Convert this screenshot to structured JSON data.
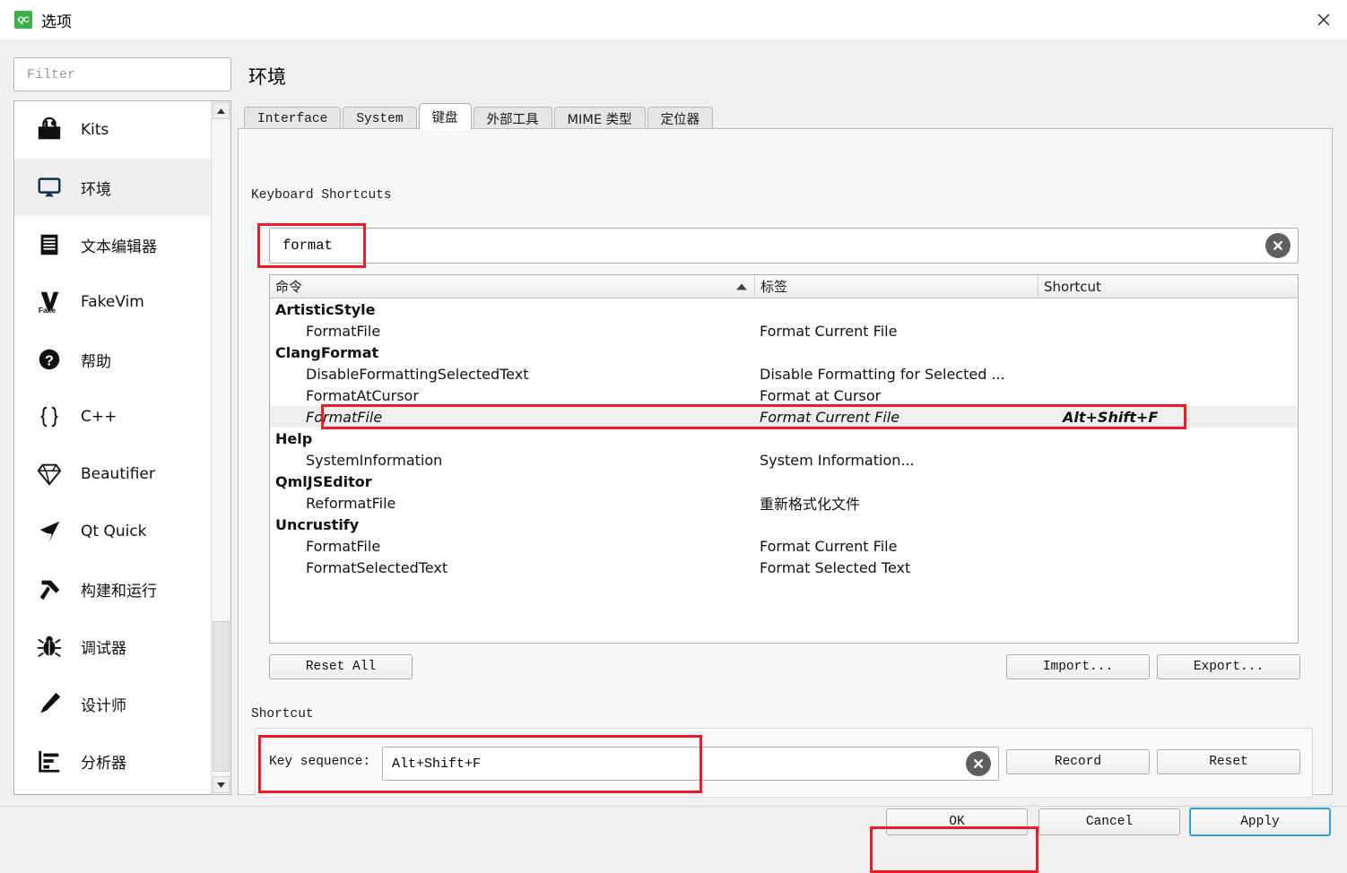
{
  "window": {
    "title": "选项",
    "app_badge": "QC",
    "close_icon": "close-icon"
  },
  "sidebar": {
    "filter_placeholder": "Filter",
    "filter_value": "",
    "selected": "环境",
    "items": [
      {
        "label": "Kits",
        "icon": "kits-toolbox-icon"
      },
      {
        "label": "环境",
        "icon": "monitor-icon"
      },
      {
        "label": "文本编辑器",
        "icon": "document-lines-icon"
      },
      {
        "label": "FakeVim",
        "icon": "fakevim-icon"
      },
      {
        "label": "帮助",
        "icon": "question-mark-icon"
      },
      {
        "label": "C++",
        "icon": "curly-braces-icon"
      },
      {
        "label": "Beautifier",
        "icon": "diamond-icon"
      },
      {
        "label": "Qt Quick",
        "icon": "paper-plane-icon"
      },
      {
        "label": "构建和运行",
        "icon": "hammer-icon"
      },
      {
        "label": "调试器",
        "icon": "bug-icon"
      },
      {
        "label": "设计师",
        "icon": "pencil-icon"
      },
      {
        "label": "分析器",
        "icon": "bar-analysis-icon"
      }
    ]
  },
  "page": {
    "title": "环境"
  },
  "tabs": [
    {
      "label": "Interface",
      "active": false,
      "cjk": false
    },
    {
      "label": "System",
      "active": false,
      "cjk": false
    },
    {
      "label": "键盘",
      "active": true,
      "cjk": true
    },
    {
      "label": "外部工具",
      "active": false,
      "cjk": true
    },
    {
      "label": "MIME 类型",
      "active": false,
      "cjk": true
    },
    {
      "label": "定位器",
      "active": false,
      "cjk": true
    }
  ],
  "keyboard": {
    "group_label": "Keyboard Shortcuts",
    "search_value": "format",
    "search_placeholder": "",
    "clear_icon": "clear-circle-icon",
    "columns": [
      "命令",
      "标签",
      "Shortcut"
    ],
    "sort_column": "命令",
    "sort_direction": "ascending",
    "rows": [
      {
        "command": "ArtisticStyle",
        "label": "",
        "shortcut": "",
        "type": "group"
      },
      {
        "command": "FormatFile",
        "label": "Format Current File",
        "shortcut": "",
        "type": "child"
      },
      {
        "command": "ClangFormat",
        "label": "",
        "shortcut": "",
        "type": "group"
      },
      {
        "command": "DisableFormattingSelectedText",
        "label": "Disable Formatting for Selected ...",
        "shortcut": "",
        "type": "child"
      },
      {
        "command": "FormatAtCursor",
        "label": "Format at Cursor",
        "shortcut": "",
        "type": "child"
      },
      {
        "command": "FormatFile",
        "label": "Format Current File",
        "shortcut": "Alt+Shift+F",
        "type": "child",
        "selected": true
      },
      {
        "command": "Help",
        "label": "",
        "shortcut": "",
        "type": "group"
      },
      {
        "command": "SystemInformation",
        "label": "System Information...",
        "shortcut": "",
        "type": "child"
      },
      {
        "command": "QmlJSEditor",
        "label": "",
        "shortcut": "",
        "type": "group"
      },
      {
        "command": "ReformatFile",
        "label": "重新格式化文件",
        "shortcut": "",
        "type": "child"
      },
      {
        "command": "Uncrustify",
        "label": "",
        "shortcut": "",
        "type": "group"
      },
      {
        "command": "FormatFile",
        "label": "Format Current File",
        "shortcut": "",
        "type": "child"
      },
      {
        "command": "FormatSelectedText",
        "label": "Format Selected Text",
        "shortcut": "",
        "type": "child"
      }
    ],
    "reset_all_label": "Reset All",
    "import_label": "Import...",
    "export_label": "Export..."
  },
  "shortcut_section": {
    "label": "Shortcut",
    "key_sequence_label": "Key sequence:",
    "key_sequence_value": "Alt+Shift+F",
    "clear_icon": "clear-circle-icon",
    "record_label": "Record",
    "reset_label": "Reset"
  },
  "footer": {
    "ok_label": "OK",
    "cancel_label": "Cancel",
    "apply_label": "Apply",
    "focused_button": "Apply"
  },
  "colors": {
    "accent_green": "#3cae4a",
    "annotation_red": "#ee1c25",
    "focus_blue": "#29a0e0",
    "selection_gray": "#efefef"
  }
}
